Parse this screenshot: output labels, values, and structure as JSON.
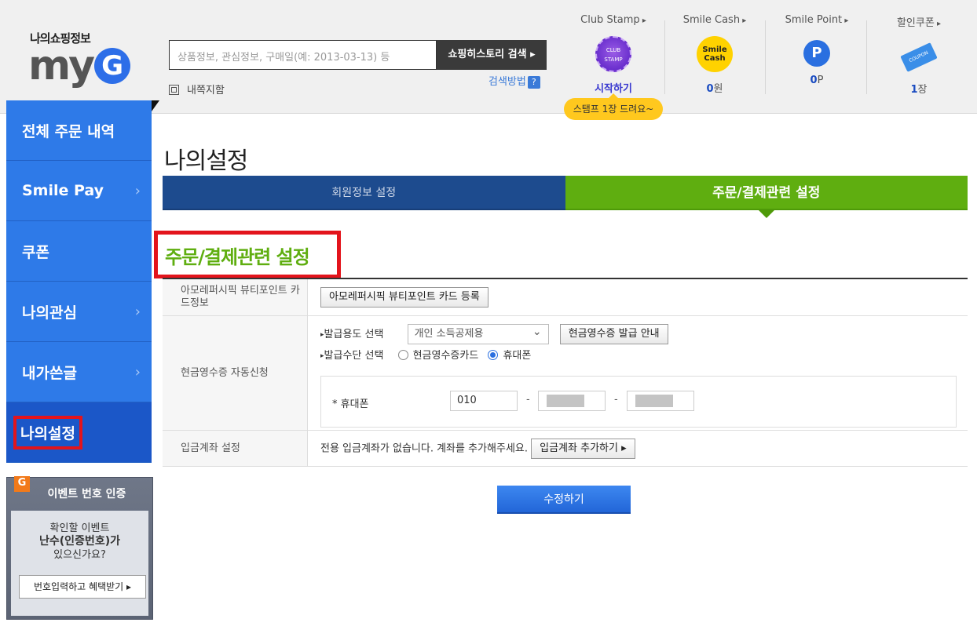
{
  "header": {
    "logo_sub": "나의쇼핑정보",
    "logo_main": "my",
    "logo_g": "G",
    "search_placeholder": "상품정보, 관심정보, 구매일(예: 2013-03-13) 등",
    "search_button": "쇼핑히스토리 검색 ▸",
    "search_help": "검색방법",
    "search_help_badge": "?",
    "wide_view": "내쪽지함",
    "club_stamp": {
      "title": "Club Stamp",
      "icon_text": "CLUB STAMP",
      "action": "시작하기",
      "tip": "스탬프 1장 드려요~"
    },
    "smile_cash": {
      "title": "Smile Cash",
      "icon_text": "Smile Cash",
      "value": "0",
      "unit": "원"
    },
    "smile_point": {
      "title": "Smile Point",
      "icon_text": "P",
      "value": "0",
      "unit": "P"
    },
    "coupon": {
      "title": "할인쿠폰",
      "icon_text": "COUPON",
      "value": "1",
      "unit": "장"
    }
  },
  "sidebar": {
    "items": [
      {
        "label": "전체 주문 내역",
        "chevron": ""
      },
      {
        "label": "Smile Pay",
        "chevron": "›"
      },
      {
        "label": "쿠폰",
        "chevron": ""
      },
      {
        "label": "나의관심",
        "chevron": "›"
      },
      {
        "label": "내가쓴글",
        "chevron": "›"
      },
      {
        "label": "나의설정",
        "chevron": ""
      }
    ],
    "event": {
      "badge": "G",
      "title": "이벤트 번호 인증",
      "line1": "확인할 이벤트",
      "line2": "난수(인증번호)가",
      "line3": "있으신가요?",
      "button": "번호입력하고 혜택받기 ▸"
    }
  },
  "main": {
    "page_title": "나의설정",
    "tabs": [
      {
        "label": "회원정보 설정"
      },
      {
        "label": "주문/결제관련 설정"
      }
    ],
    "section_title": "주문/결제관련 설정",
    "rows": {
      "beauty": {
        "label": "아모레퍼시픽 뷰티포인트 카드정보",
        "button": "아모레퍼시픽 뷰티포인트 카드 등록"
      },
      "receipt": {
        "label": "현금영수증 자동신청",
        "purpose_label": "발급용도 선택",
        "purpose_value": "개인 소득공제용",
        "guide_button": "현금영수증 발급 안내",
        "method_label": "발급수단 선택",
        "method_card": "현금영수증카드",
        "method_phone": "휴대폰",
        "phone_label": "* 휴대폰",
        "phone_prefix": "010",
        "dash": "-"
      },
      "account": {
        "label": "입금계좌 설정",
        "text": "전용 입금계좌가 없습니다. 계좌를 추가해주세요.",
        "button": "입금계좌 추가하기 ▸"
      }
    },
    "submit": "수정하기"
  },
  "colors": {
    "sidebar_blue": "#2e7ae8",
    "active_green": "#5fae10",
    "tab_navy": "#1d4b8e",
    "highlight_red": "#e3141c"
  }
}
